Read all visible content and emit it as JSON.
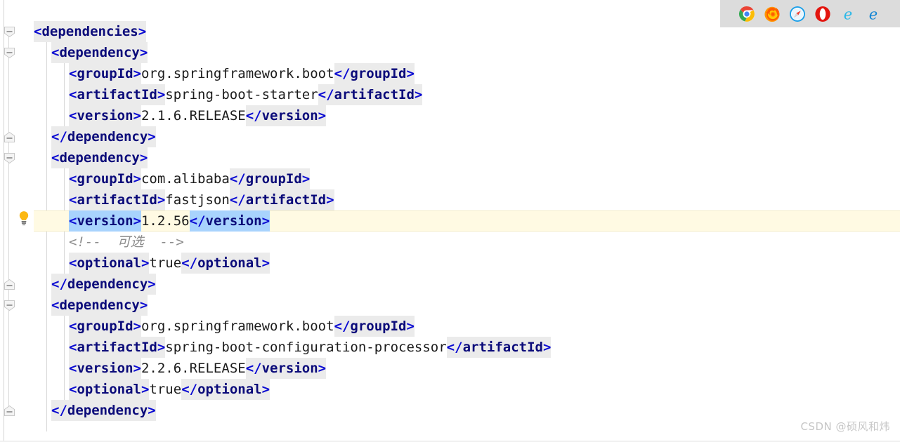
{
  "editor": {
    "language": "XML",
    "file_label": "pom.xml",
    "font_size_px": 19,
    "line_height_px": 30,
    "colors": {
      "background": "#ffffff",
      "tag_bracket": "#0a0ad2",
      "tag_name": "#0b0b7a",
      "text": "#1c1c1c",
      "comment": "#8c8c8c",
      "tag_highlight_bg": "#ebebeb",
      "selection_bg": "#a8d3fd",
      "current_line_bg": "#fffae3",
      "indent_guide": "#d8d8d8",
      "gutter_separator": "#d4d4d4"
    },
    "current_line_index": 9,
    "lines": [
      {
        "indent": 0,
        "tokens": [
          {
            "kind": "bracket",
            "text": "<",
            "bg": "tag"
          },
          {
            "kind": "tagname",
            "text": "dependencies",
            "bg": "tag"
          },
          {
            "kind": "bracket",
            "text": ">",
            "bg": "tag"
          }
        ]
      },
      {
        "indent": 1,
        "tokens": [
          {
            "kind": "bracket",
            "text": "<",
            "bg": "tag"
          },
          {
            "kind": "tagname",
            "text": "dependency",
            "bg": "tag"
          },
          {
            "kind": "bracket",
            "text": ">",
            "bg": "tag"
          }
        ]
      },
      {
        "indent": 2,
        "tokens": [
          {
            "kind": "bracket",
            "text": "<",
            "bg": "tag"
          },
          {
            "kind": "tagname",
            "text": "groupId",
            "bg": "tag"
          },
          {
            "kind": "bracket",
            "text": ">",
            "bg": "tag"
          },
          {
            "kind": "text",
            "text": "org.springframework.boot",
            "bg": "none"
          },
          {
            "kind": "bracket",
            "text": "</",
            "bg": "tag"
          },
          {
            "kind": "tagname",
            "text": "groupId",
            "bg": "tag"
          },
          {
            "kind": "bracket",
            "text": ">",
            "bg": "tag"
          }
        ]
      },
      {
        "indent": 2,
        "tokens": [
          {
            "kind": "bracket",
            "text": "<",
            "bg": "tag"
          },
          {
            "kind": "tagname",
            "text": "artifactId",
            "bg": "tag"
          },
          {
            "kind": "bracket",
            "text": ">",
            "bg": "tag"
          },
          {
            "kind": "text",
            "text": "spring-boot-starter",
            "bg": "none"
          },
          {
            "kind": "bracket",
            "text": "</",
            "bg": "tag"
          },
          {
            "kind": "tagname",
            "text": "artifactId",
            "bg": "tag"
          },
          {
            "kind": "bracket",
            "text": ">",
            "bg": "tag"
          }
        ]
      },
      {
        "indent": 2,
        "tokens": [
          {
            "kind": "bracket",
            "text": "<",
            "bg": "tag"
          },
          {
            "kind": "tagname",
            "text": "version",
            "bg": "tag"
          },
          {
            "kind": "bracket",
            "text": ">",
            "bg": "tag"
          },
          {
            "kind": "text",
            "text": "2.1.6.RELEASE",
            "bg": "none"
          },
          {
            "kind": "bracket",
            "text": "</",
            "bg": "tag"
          },
          {
            "kind": "tagname",
            "text": "version",
            "bg": "tag"
          },
          {
            "kind": "bracket",
            "text": ">",
            "bg": "tag"
          }
        ]
      },
      {
        "indent": 1,
        "tokens": [
          {
            "kind": "bracket",
            "text": "</",
            "bg": "tag"
          },
          {
            "kind": "tagname",
            "text": "dependency",
            "bg": "tag"
          },
          {
            "kind": "bracket",
            "text": ">",
            "bg": "tag"
          }
        ]
      },
      {
        "indent": 1,
        "tokens": [
          {
            "kind": "bracket",
            "text": "<",
            "bg": "tag"
          },
          {
            "kind": "tagname",
            "text": "dependency",
            "bg": "tag"
          },
          {
            "kind": "bracket",
            "text": ">",
            "bg": "tag"
          }
        ]
      },
      {
        "indent": 2,
        "tokens": [
          {
            "kind": "bracket",
            "text": "<",
            "bg": "tag"
          },
          {
            "kind": "tagname",
            "text": "groupId",
            "bg": "tag"
          },
          {
            "kind": "bracket",
            "text": ">",
            "bg": "tag"
          },
          {
            "kind": "text",
            "text": "com.alibaba",
            "bg": "none"
          },
          {
            "kind": "bracket",
            "text": "</",
            "bg": "tag"
          },
          {
            "kind": "tagname",
            "text": "groupId",
            "bg": "tag"
          },
          {
            "kind": "bracket",
            "text": ">",
            "bg": "tag"
          }
        ]
      },
      {
        "indent": 2,
        "tokens": [
          {
            "kind": "bracket",
            "text": "<",
            "bg": "tag"
          },
          {
            "kind": "tagname",
            "text": "artifactId",
            "bg": "tag"
          },
          {
            "kind": "bracket",
            "text": ">",
            "bg": "tag"
          },
          {
            "kind": "text",
            "text": "fastjson",
            "bg": "none"
          },
          {
            "kind": "bracket",
            "text": "</",
            "bg": "tag"
          },
          {
            "kind": "tagname",
            "text": "artifactId",
            "bg": "tag"
          },
          {
            "kind": "bracket",
            "text": ">",
            "bg": "tag"
          }
        ]
      },
      {
        "indent": 2,
        "tokens": [
          {
            "kind": "bracket",
            "text": "<",
            "bg": "sel"
          },
          {
            "kind": "tagname",
            "text": "version",
            "bg": "sel"
          },
          {
            "kind": "bracket",
            "text": ">",
            "bg": "sel"
          },
          {
            "kind": "text",
            "text": "1.2.56",
            "bg": "none"
          },
          {
            "kind": "bracket",
            "text": "</",
            "bg": "sel"
          },
          {
            "kind": "tagname",
            "text": "version",
            "bg": "sel"
          },
          {
            "kind": "bracket",
            "text": ">",
            "bg": "sel"
          }
        ]
      },
      {
        "indent": 2,
        "tokens": [
          {
            "kind": "comment",
            "text": "<!--  可选  -->",
            "bg": "none"
          }
        ]
      },
      {
        "indent": 2,
        "tokens": [
          {
            "kind": "bracket",
            "text": "<",
            "bg": "tag"
          },
          {
            "kind": "tagname",
            "text": "optional",
            "bg": "tag"
          },
          {
            "kind": "bracket",
            "text": ">",
            "bg": "tag"
          },
          {
            "kind": "text",
            "text": "true",
            "bg": "none"
          },
          {
            "kind": "bracket",
            "text": "</",
            "bg": "tag"
          },
          {
            "kind": "tagname",
            "text": "optional",
            "bg": "tag"
          },
          {
            "kind": "bracket",
            "text": ">",
            "bg": "tag"
          }
        ]
      },
      {
        "indent": 1,
        "tokens": [
          {
            "kind": "bracket",
            "text": "</",
            "bg": "tag"
          },
          {
            "kind": "tagname",
            "text": "dependency",
            "bg": "tag"
          },
          {
            "kind": "bracket",
            "text": ">",
            "bg": "tag"
          }
        ]
      },
      {
        "indent": 1,
        "tokens": [
          {
            "kind": "bracket",
            "text": "<",
            "bg": "tag"
          },
          {
            "kind": "tagname",
            "text": "dependency",
            "bg": "tag"
          },
          {
            "kind": "bracket",
            "text": ">",
            "bg": "tag"
          }
        ]
      },
      {
        "indent": 2,
        "tokens": [
          {
            "kind": "bracket",
            "text": "<",
            "bg": "tag"
          },
          {
            "kind": "tagname",
            "text": "groupId",
            "bg": "tag"
          },
          {
            "kind": "bracket",
            "text": ">",
            "bg": "tag"
          },
          {
            "kind": "text",
            "text": "org.springframework.boot",
            "bg": "none"
          },
          {
            "kind": "bracket",
            "text": "</",
            "bg": "tag"
          },
          {
            "kind": "tagname",
            "text": "groupId",
            "bg": "tag"
          },
          {
            "kind": "bracket",
            "text": ">",
            "bg": "tag"
          }
        ]
      },
      {
        "indent": 2,
        "tokens": [
          {
            "kind": "bracket",
            "text": "<",
            "bg": "tag"
          },
          {
            "kind": "tagname",
            "text": "artifactId",
            "bg": "tag"
          },
          {
            "kind": "bracket",
            "text": ">",
            "bg": "tag"
          },
          {
            "kind": "text",
            "text": "spring-boot-configuration-processor",
            "bg": "none"
          },
          {
            "kind": "bracket",
            "text": "</",
            "bg": "tag"
          },
          {
            "kind": "tagname",
            "text": "artifactId",
            "bg": "tag"
          },
          {
            "kind": "bracket",
            "text": ">",
            "bg": "tag"
          }
        ]
      },
      {
        "indent": 2,
        "tokens": [
          {
            "kind": "bracket",
            "text": "<",
            "bg": "tag"
          },
          {
            "kind": "tagname",
            "text": "version",
            "bg": "tag"
          },
          {
            "kind": "bracket",
            "text": ">",
            "bg": "tag"
          },
          {
            "kind": "text",
            "text": "2.2.6.RELEASE",
            "bg": "none"
          },
          {
            "kind": "bracket",
            "text": "</",
            "bg": "tag"
          },
          {
            "kind": "tagname",
            "text": "version",
            "bg": "tag"
          },
          {
            "kind": "bracket",
            "text": ">",
            "bg": "tag"
          }
        ]
      },
      {
        "indent": 2,
        "tokens": [
          {
            "kind": "bracket",
            "text": "<",
            "bg": "tag"
          },
          {
            "kind": "tagname",
            "text": "optional",
            "bg": "tag"
          },
          {
            "kind": "bracket",
            "text": ">",
            "bg": "tag"
          },
          {
            "kind": "text",
            "text": "true",
            "bg": "none"
          },
          {
            "kind": "bracket",
            "text": "</",
            "bg": "tag"
          },
          {
            "kind": "tagname",
            "text": "optional",
            "bg": "tag"
          },
          {
            "kind": "bracket",
            "text": ">",
            "bg": "tag"
          }
        ]
      },
      {
        "indent": 1,
        "tokens": [
          {
            "kind": "bracket",
            "text": "</",
            "bg": "tag"
          },
          {
            "kind": "tagname",
            "text": "dependency",
            "bg": "tag"
          },
          {
            "kind": "bracket",
            "text": ">",
            "bg": "tag"
          }
        ]
      }
    ]
  },
  "gutter": {
    "intention_bulb": {
      "icon": "lightbulb-icon",
      "tooltip": "Show intention actions",
      "line_index": 9
    },
    "fold_markers": [
      {
        "icon": "fold-collapse-icon",
        "state": "expanded",
        "line_index": 0
      },
      {
        "icon": "fold-collapse-icon",
        "state": "expanded",
        "line_index": 1
      },
      {
        "icon": "fold-end-icon",
        "state": "expanded",
        "line_index": 5
      },
      {
        "icon": "fold-collapse-icon",
        "state": "expanded",
        "line_index": 6
      },
      {
        "icon": "fold-end-icon",
        "state": "expanded",
        "line_index": 12
      },
      {
        "icon": "fold-collapse-icon",
        "state": "expanded",
        "line_index": 13
      },
      {
        "icon": "fold-end-icon",
        "state": "expanded",
        "line_index": 18
      }
    ]
  },
  "browser_toolbar": {
    "background": "#dcdcdc",
    "items": [
      {
        "icon": "chrome-icon",
        "label": "Chrome"
      },
      {
        "icon": "firefox-icon",
        "label": "Firefox"
      },
      {
        "icon": "safari-icon",
        "label": "Safari"
      },
      {
        "icon": "opera-icon",
        "label": "Opera"
      },
      {
        "icon": "internet-explorer-icon",
        "label": "Internet Explorer"
      },
      {
        "icon": "edge-icon",
        "label": "Edge"
      }
    ]
  },
  "watermark": {
    "text": "CSDN @硕风和炜"
  }
}
